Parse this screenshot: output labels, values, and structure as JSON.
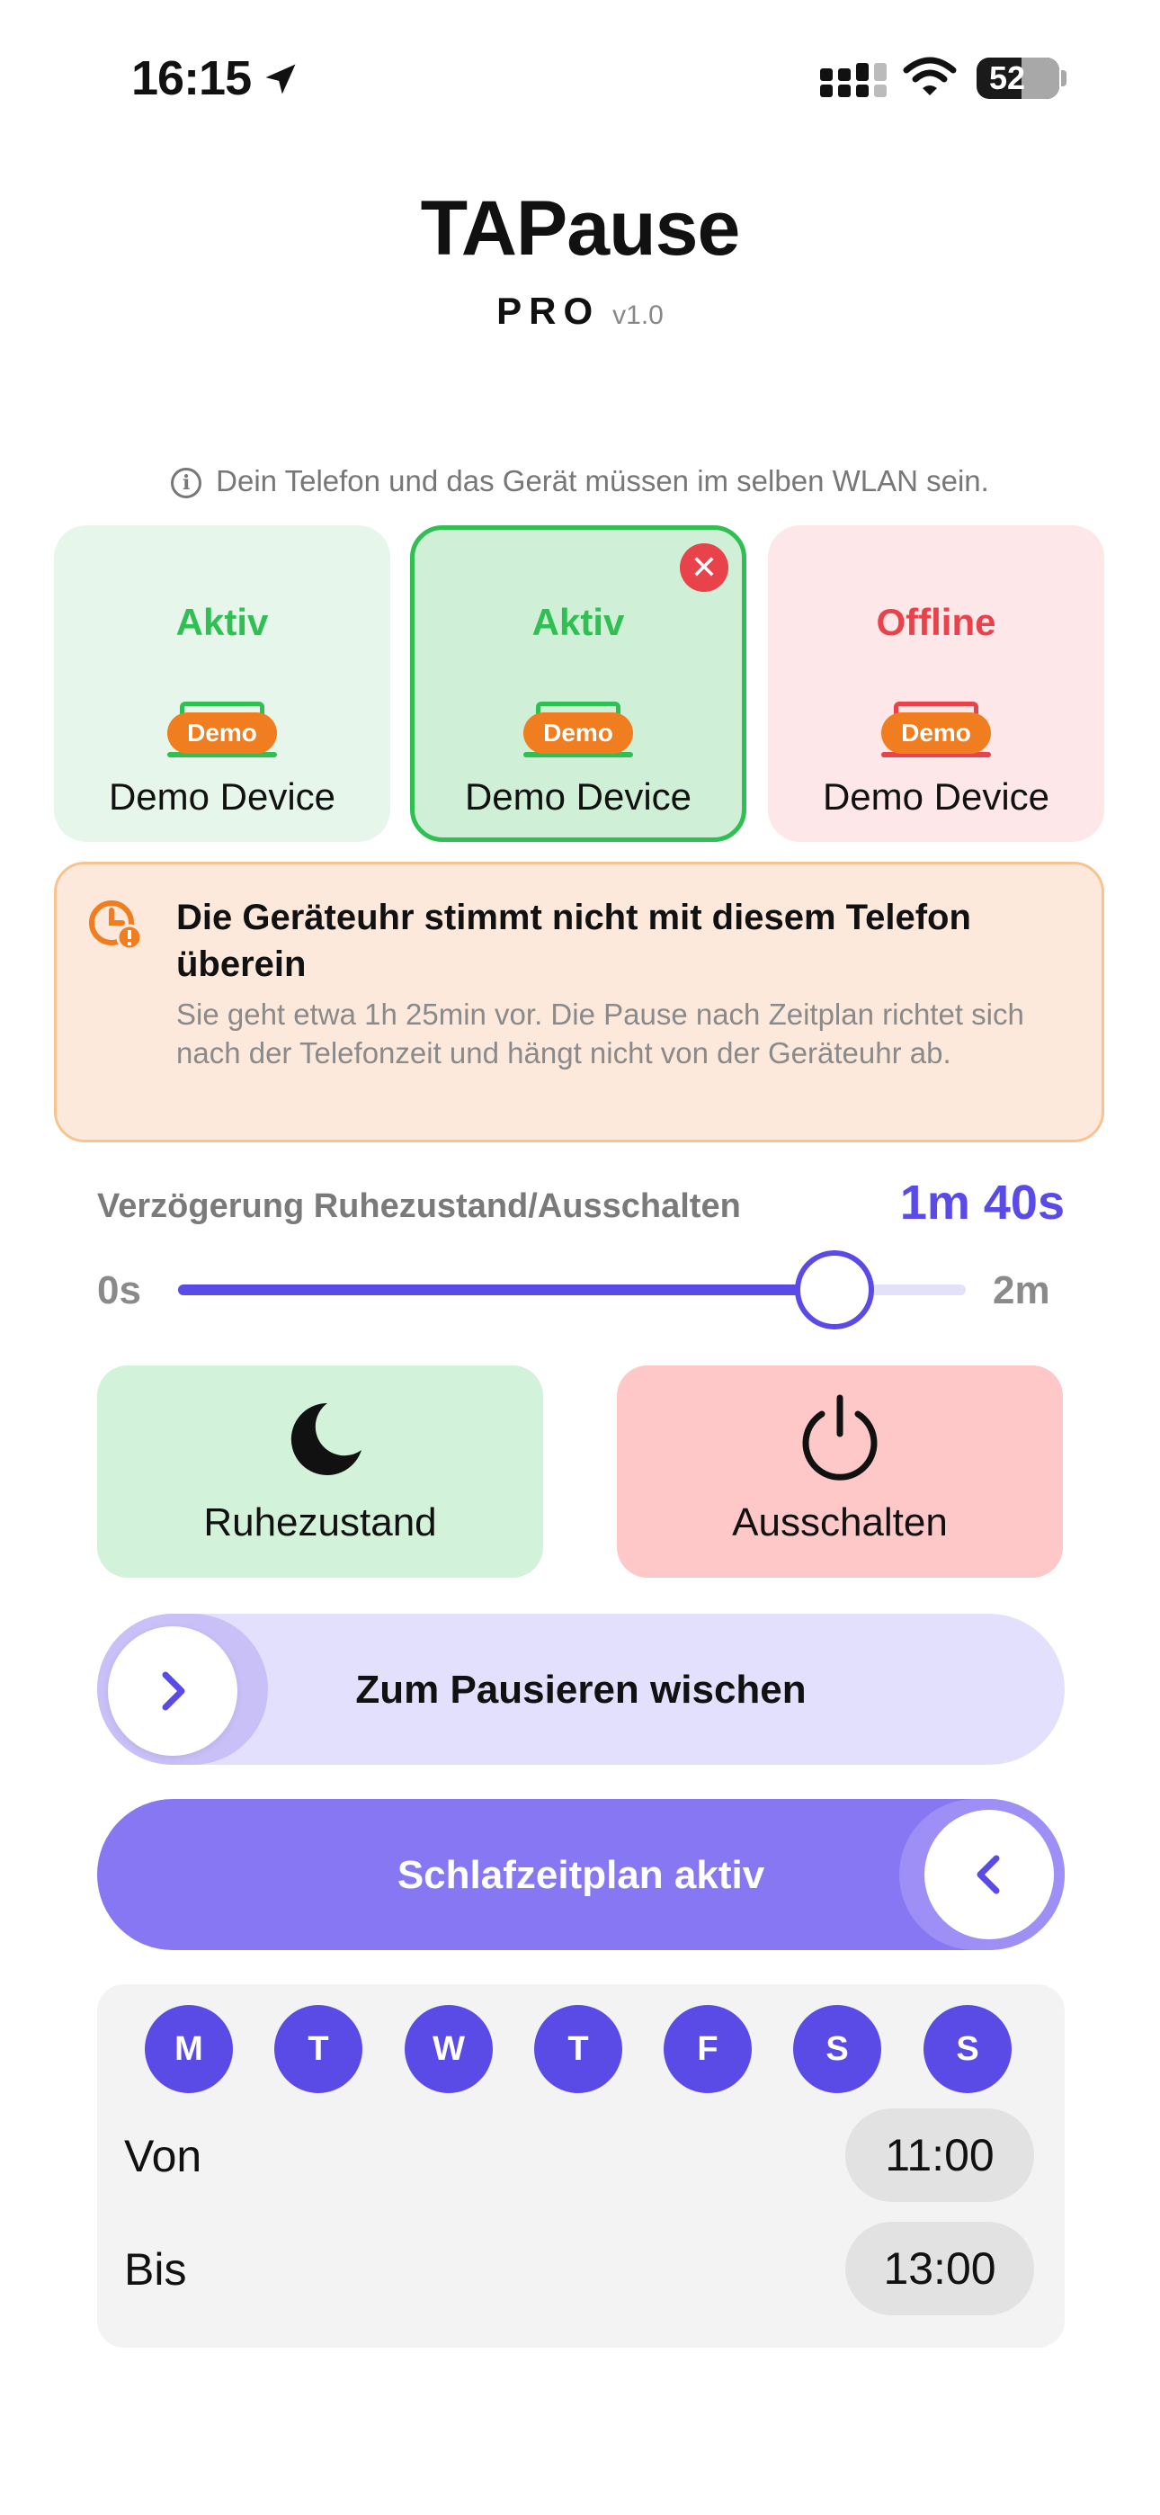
{
  "status_bar": {
    "time": "16:15",
    "battery": "52"
  },
  "header": {
    "title": "TAPause",
    "edition": "PRO",
    "version": "v1.0"
  },
  "info": {
    "text": "Dein Telefon und das Gerät müssen im selben WLAN sein."
  },
  "devices": [
    {
      "status": "Aktiv",
      "name": "Demo Device",
      "badge": "Demo",
      "selected": false,
      "color": "#2fbf52"
    },
    {
      "status": "Aktiv",
      "name": "Demo Device",
      "badge": "Demo",
      "selected": true,
      "color": "#2fbf52"
    },
    {
      "status": "Offline",
      "name": "Demo Device",
      "badge": "Demo",
      "selected": false,
      "color": "#e8424a"
    }
  ],
  "warning": {
    "title": "Die Geräteuhr stimmt nicht mit diesem Telefon überein",
    "body": "Sie geht etwa 1h 25min vor. Die Pause nach Zeitplan richtet sich nach der Telefonzeit und hängt nicht von der Geräteuhr ab."
  },
  "delay": {
    "label": "Verzögerung Ruhezustand/Ausschalten",
    "value": "1m 40s",
    "min_label": "0s",
    "max_label": "2m",
    "fraction": 0.8333
  },
  "actions": {
    "sleep_label": "Ruhezustand",
    "power_label": "Ausschalten"
  },
  "swipe_pause": {
    "label": "Zum Pausieren wischen"
  },
  "schedule_toggle": {
    "label": "Schlafzeitplan aktiv"
  },
  "schedule": {
    "days": [
      "M",
      "T",
      "W",
      "T",
      "F",
      "S",
      "S"
    ],
    "from_label": "Von",
    "from_value": "11:00",
    "to_label": "Bis",
    "to_value": "13:00"
  },
  "colors": {
    "accent": "#5a4be6",
    "active_green": "#2fbf52",
    "offline_red": "#e8424a",
    "demo_orange": "#f07d1f"
  }
}
